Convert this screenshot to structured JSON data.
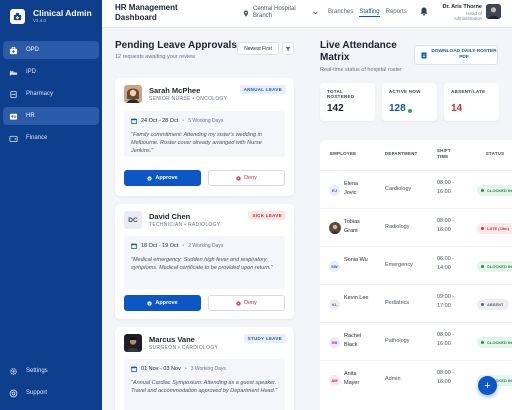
{
  "sidebar": {
    "brand": "Clinical Admin",
    "version": "V2.4.0",
    "items": [
      {
        "label": "OPD",
        "icon": "briefcase-medical-icon",
        "active": true
      },
      {
        "label": "IPD",
        "icon": "bed-icon",
        "active": false
      },
      {
        "label": "Pharmacy",
        "icon": "pill-icon",
        "active": false
      },
      {
        "label": "HR",
        "icon": "badge-icon",
        "active": true
      },
      {
        "label": "Finance",
        "icon": "wallet-icon",
        "active": false
      }
    ],
    "bottom": [
      {
        "label": "Settings",
        "icon": "gear-icon"
      },
      {
        "label": "Support",
        "icon": "help-icon"
      }
    ]
  },
  "header": {
    "title": "HR Management Dashboard",
    "branch": "Central Hospital Branch",
    "links": [
      "Branches",
      "Staffing",
      "Reports"
    ],
    "active_link": "Staffing",
    "user_name": "Dr. Aris Thorne",
    "user_role": "Head of Administration"
  },
  "pending": {
    "title": "Pending Leave Approvals",
    "subtitle": "12 requests awaiting your review",
    "sort_label": "Newest First",
    "approve_label": "Approve",
    "deny_label": "Deny",
    "requests": [
      {
        "name": "Sarah McPhee",
        "role": "SENIOR NURSE • ONCOLOGY",
        "badge": "ANNUAL LEAVE",
        "badge_color": "#1a56c4",
        "badge_bg": "#e7efff",
        "dates": "24 Oct - 28 Oct",
        "days": "5 Working Days",
        "reason": "\"Family commitment: Attending my sister's wedding in Melbourne. Roster cover already arranged with Nurse Jenkins.\""
      },
      {
        "name": "David Chen",
        "initials": "DC",
        "role": "TECHNICIAN • RADIOLOGY",
        "badge": "SICK LEAVE",
        "badge_color": "#c62828",
        "badge_bg": "#fde8e8",
        "dates": "18 Oct - 19 Oct",
        "days": "2 Working Days",
        "reason": "\"Medical emergency: Sudden high fever and respiratory symptoms. Medical certificate to be provided upon return.\""
      },
      {
        "name": "Marcus Vane",
        "role": "SURGEON • CARDIOLOGY",
        "badge": "STUDY LEAVE",
        "badge_color": "#1a56c4",
        "badge_bg": "#e7efff",
        "dates": "01 Nov - 03 Nov",
        "days": "3 Working Days",
        "reason": "\"Annual Cardiac Symposium: Attending as a guest speaker. Travel and accommodation approved by Department Head.\""
      }
    ]
  },
  "attendance": {
    "title": "Live Attendance Matrix",
    "subtitle": "Real-time status of hospital roster",
    "download_label": "DOWNLOAD DAILY ROSTER PDF",
    "stats": [
      {
        "label": "TOTAL ROSTERED",
        "value": "142",
        "color": "#1c2230"
      },
      {
        "label": "ACTIVE NOW",
        "value": "128",
        "color": "#0d56c5"
      },
      {
        "label": "ABSENT/LATE",
        "value": "14",
        "color": "#d03030"
      }
    ],
    "columns": [
      "EMPLOYEE",
      "DEPARTMENT",
      "SHIFT TIME",
      "STATUS"
    ],
    "rows": [
      {
        "initials": "EJ",
        "name": "Elena Jovic",
        "dept": "Cardiology",
        "shift": "08:00 - 16:00",
        "status": "CLOCKED IN",
        "av_bg": "#e6eefc",
        "av_fg": "#2a5aa8",
        "st_bg": "#e3f6e9",
        "st_fg": "#2e8b4e"
      },
      {
        "initials": "",
        "name": "Tobias Grant",
        "dept": "Radiology",
        "shift": "08:00 - 16:00",
        "status": "LATE (15m)",
        "av_bg": "#5a4a3a",
        "av_fg": "#fff",
        "st_bg": "#fde8e8",
        "st_fg": "#d03030"
      },
      {
        "initials": "SW",
        "name": "Sonia Wu",
        "dept": "Emergency",
        "shift": "06:00 - 14:00",
        "status": "CLOCKED IN",
        "av_bg": "#e6eefc",
        "av_fg": "#2a5aa8",
        "st_bg": "#e3f6e9",
        "st_fg": "#2e8b4e"
      },
      {
        "initials": "KL",
        "name": "Kevin Lee",
        "dept": "Pediatrics",
        "shift": "09:00 - 17:00",
        "status": "ABSENT",
        "av_bg": "#eceef2",
        "av_fg": "#5c6575",
        "st_bg": "#eceef2",
        "st_fg": "#5c6575"
      },
      {
        "initials": "RB",
        "name": "Rachel Black",
        "dept": "Pathology",
        "shift": "08:00 - 16:00",
        "status": "CLOCKED IN",
        "av_bg": "#f1e8fb",
        "av_fg": "#7a3fb8",
        "st_bg": "#e3f6e9",
        "st_fg": "#2e8b4e"
      },
      {
        "initials": "AM",
        "name": "Anita Mayer",
        "dept": "Admin",
        "shift": "08:00 - 16:00",
        "status": "CLOCKED IN",
        "av_bg": "#fde6ec",
        "av_fg": "#c02a5a",
        "st_bg": "#e3f6e9",
        "st_fg": "#2e8b4e"
      }
    ]
  },
  "fab_label": "+"
}
